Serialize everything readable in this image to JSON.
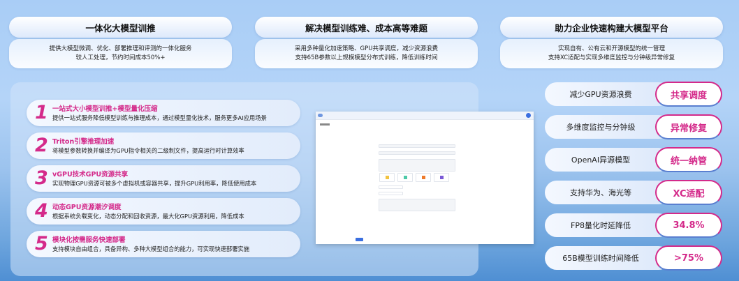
{
  "cards": [
    {
      "title": "一体化大模型训推",
      "lines": [
        "提供大模型微调、优化、部署推理和评测的一体化服务",
        "较人工处理，节约时间成本50%+"
      ]
    },
    {
      "title": "解决模型训练难、成本高等难题",
      "lines": [
        "采用多种量化加速策略、GPU共享调度，减少资源浪费",
        "支持65B参数以上规模模型分布式训练，降低训练时间"
      ]
    },
    {
      "title": "助力企业快速构建大模型平台",
      "lines": [
        "实现自有、公有云和开源模型的统一管理",
        "支持XC适配与实现多维度监控与分钟级异常修复"
      ]
    }
  ],
  "features": [
    {
      "num": "1",
      "title": "一站式大小模型训推+模型量化压缩",
      "desc": "提供一站式服务降低模型训练与推理成本，通过模型量化技术，服务更多AI应用场景"
    },
    {
      "num": "2",
      "title": "Triton引擎推理加速",
      "desc": "将模型参数转换并编译为GPU指令相关的二级制文件，提高运行时计算效率"
    },
    {
      "num": "3",
      "title": "vGPU技术GPU资源共享",
      "desc": "实现物理GPU资源可被多个虚拟机或容器共享，提升GPU利用率，降低使用成本"
    },
    {
      "num": "4",
      "title": "动态GPU资源潮汐调度",
      "desc": "根据系统负载变化，动态分配和回收资源，最大化GPU资源利用，降低成本"
    },
    {
      "num": "5",
      "title": "模块化按需服务快速部署",
      "desc": "支持模块自由组合，具备异构、多种大模型组合的能力，可实现快速部署实施"
    }
  ],
  "highlights": [
    {
      "label": "减少GPU资源浪费",
      "badge": "共享调度"
    },
    {
      "label": "多维度监控与分钟级",
      "badge": "异常修复"
    },
    {
      "label": "OpenAI异源模型",
      "badge": "统一纳管"
    },
    {
      "label": "支持华为、海光等",
      "badge": "XC适配"
    },
    {
      "label": "FP8量化时延降低",
      "badge": "34.8%"
    },
    {
      "label": "65B模型训练时间降低",
      "badge": ">75%"
    }
  ],
  "colors": {
    "accent": "#d42a8a",
    "primary": "#3b6fe0"
  }
}
